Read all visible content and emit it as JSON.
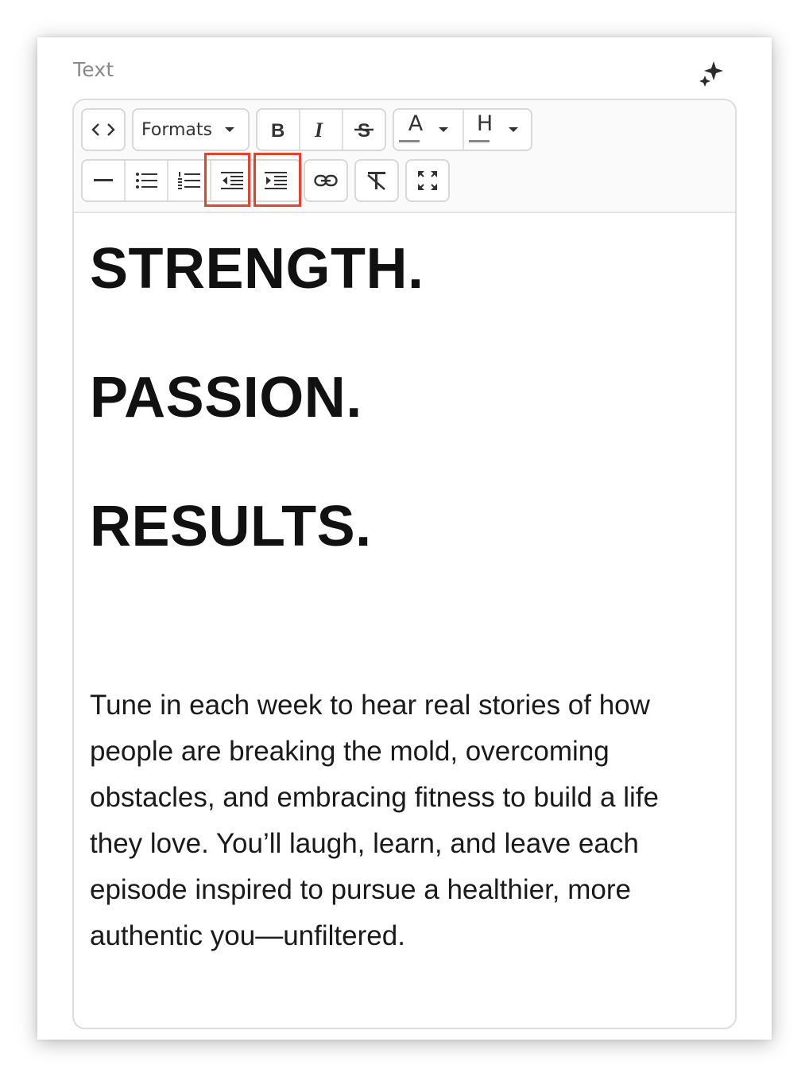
{
  "panel": {
    "title": "Text"
  },
  "toolbar": {
    "formats_label": "Formats",
    "text_color_letter": "A",
    "highlight_letter": "H",
    "highlight_color": "#e8432a"
  },
  "content": {
    "headings": [
      "STRENGTH.",
      "PASSION.",
      "RESULTS."
    ],
    "paragraph_lines": [
      "Tune in each week to hear real stories of how",
      "people are breaking the mold, overcoming",
      "obstacles, and embracing fitness to build a life",
      "they love. You’ll laugh, learn, and leave each",
      "episode inspired to pursue a healthier, more",
      "authentic you—unfiltered."
    ]
  }
}
